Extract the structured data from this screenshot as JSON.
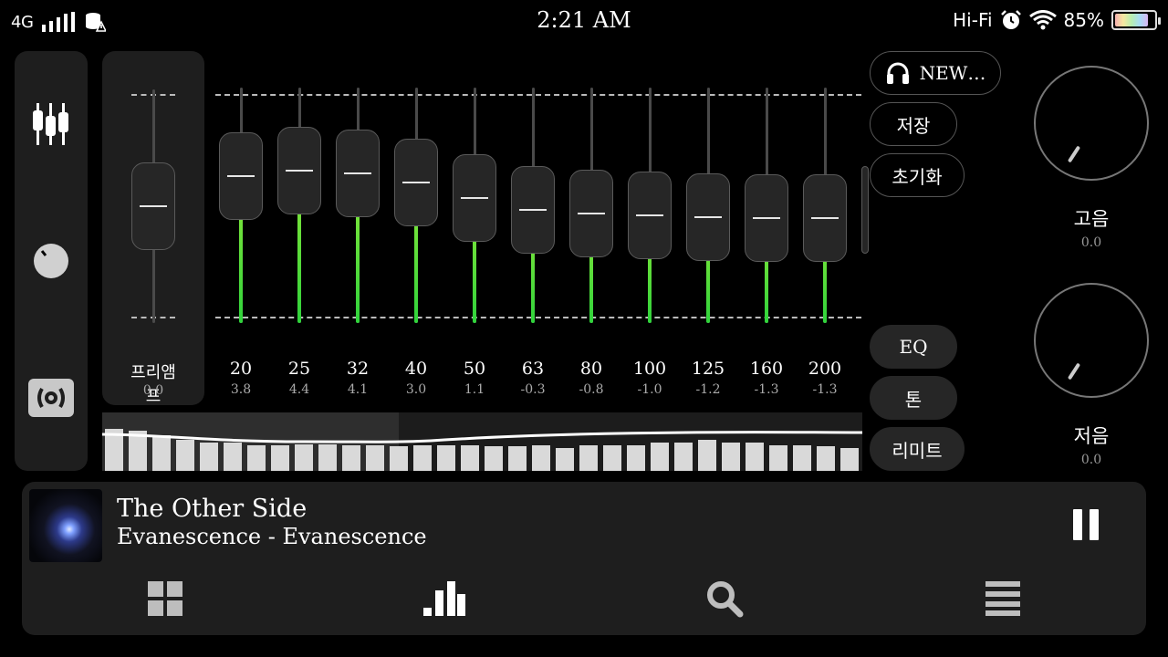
{
  "status_bar": {
    "network": "4G",
    "time": "2:21 AM",
    "hifi": "Hi-Fi",
    "battery": "85%",
    "battery_level": 0.85
  },
  "side_nav": {
    "items": [
      {
        "name": "equalizer",
        "icon": "sliders-icon"
      },
      {
        "name": "volume",
        "icon": "knob-icon"
      },
      {
        "name": "effects",
        "icon": "surround-icon"
      }
    ]
  },
  "preamp": {
    "label": "프리앰프",
    "value": "0.0"
  },
  "bands": [
    {
      "freq": "20",
      "value": "3.8"
    },
    {
      "freq": "25",
      "value": "4.4"
    },
    {
      "freq": "32",
      "value": "4.1"
    },
    {
      "freq": "40",
      "value": "3.0"
    },
    {
      "freq": "50",
      "value": "1.1"
    },
    {
      "freq": "63",
      "value": "-0.3"
    },
    {
      "freq": "80",
      "value": "-0.8"
    },
    {
      "freq": "100",
      "value": "-1.0"
    },
    {
      "freq": "125",
      "value": "-1.2"
    },
    {
      "freq": "160",
      "value": "-1.3"
    },
    {
      "freq": "200",
      "value": "-1.3"
    }
  ],
  "spectrum_levels": [
    0.82,
    0.78,
    0.7,
    0.6,
    0.55,
    0.55,
    0.5,
    0.5,
    0.52,
    0.52,
    0.5,
    0.5,
    0.48,
    0.5,
    0.5,
    0.5,
    0.48,
    0.48,
    0.5,
    0.45,
    0.5,
    0.5,
    0.5,
    0.55,
    0.55,
    0.6,
    0.55,
    0.55,
    0.5,
    0.5,
    0.48,
    0.45,
    0.4,
    0.35,
    0.3,
    0.22,
    0.18,
    0.12,
    0.08,
    0.04
  ],
  "presets": {
    "profile": "NEW…",
    "save": "저장",
    "reset": "초기화"
  },
  "modes": {
    "eq": "EQ",
    "tone": "톤",
    "limit": "리미트"
  },
  "tone": {
    "treble_label": "고음",
    "treble_value": "0.0",
    "bass_label": "저음",
    "bass_value": "0.0"
  },
  "player": {
    "title": "The Other Side",
    "artist": "Evanescence - Evanescence"
  },
  "bottom_nav": [
    {
      "name": "library",
      "icon": "grid-icon"
    },
    {
      "name": "equalizer",
      "icon": "bars-chart-icon"
    },
    {
      "name": "search",
      "icon": "search-icon"
    },
    {
      "name": "queue",
      "icon": "list-icon"
    }
  ]
}
